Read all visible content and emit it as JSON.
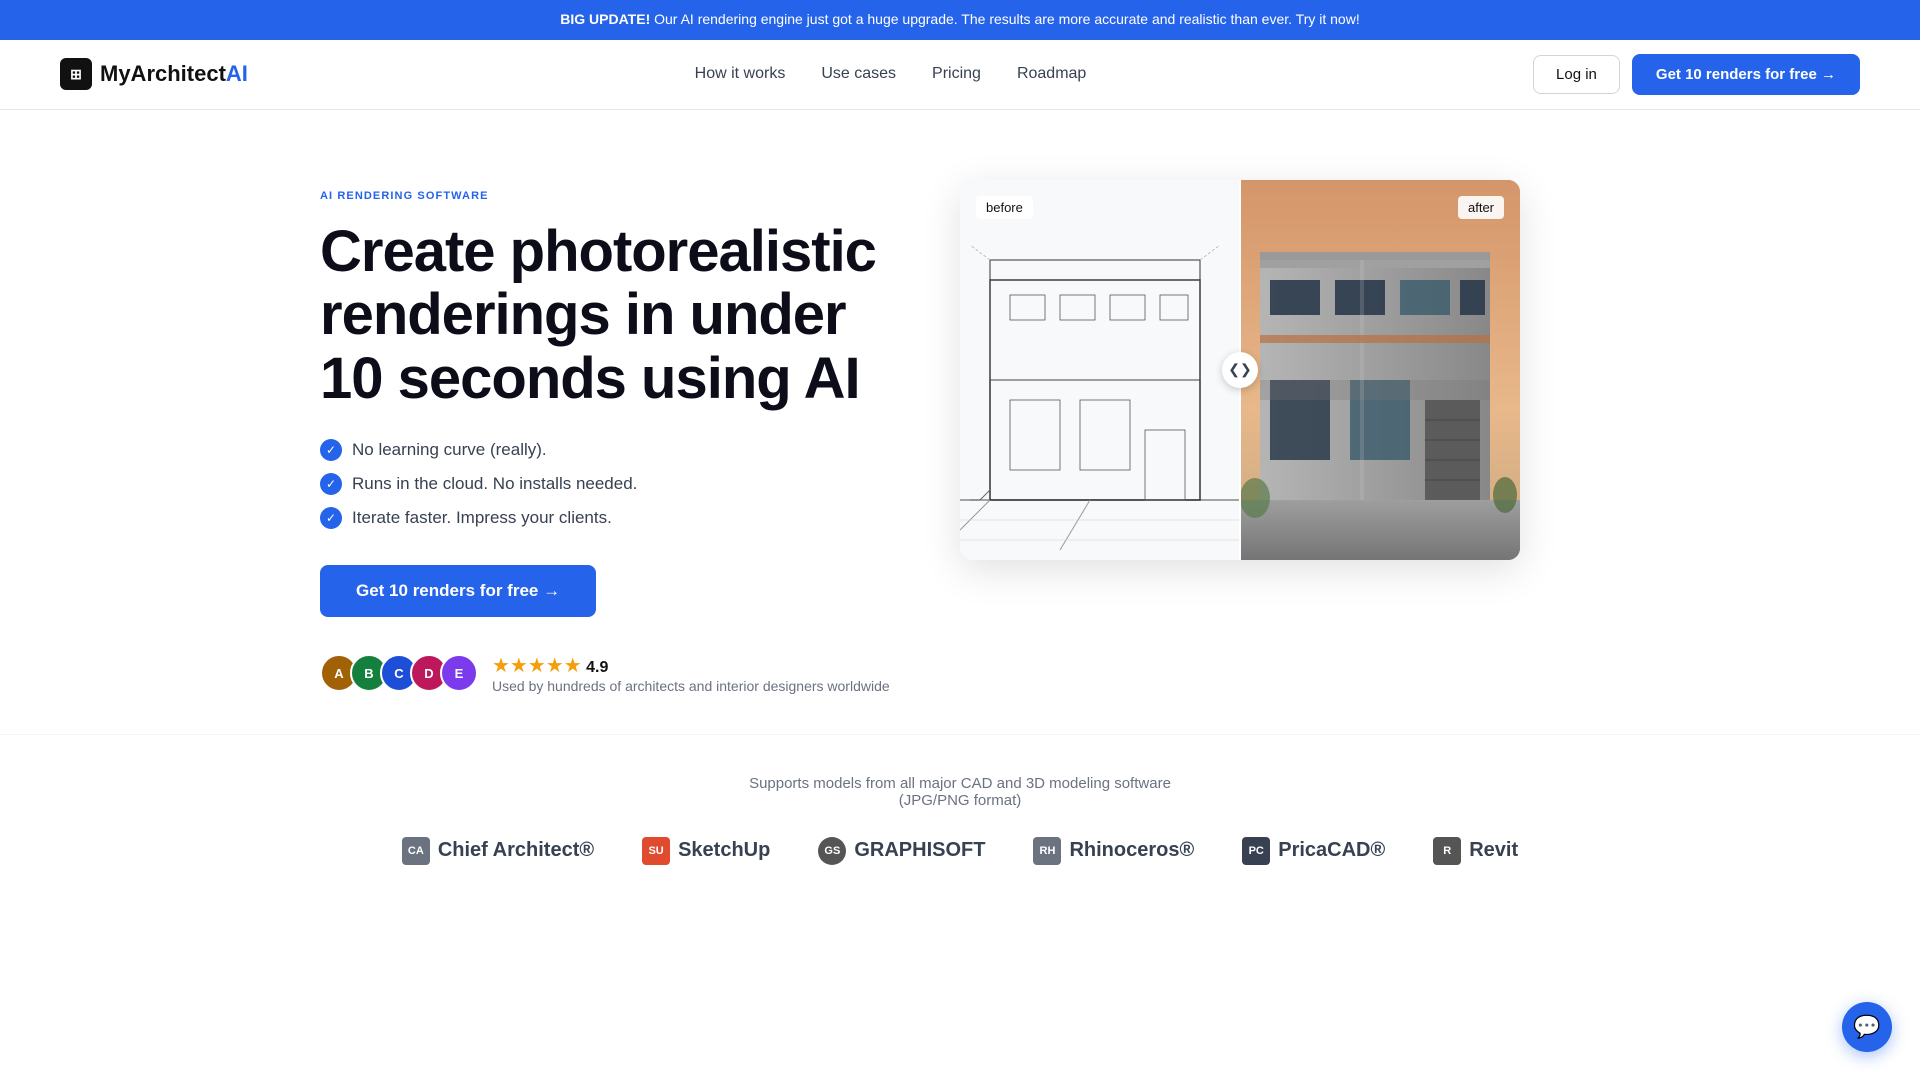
{
  "banner": {
    "bold_text": "BIG UPDATE!",
    "text": " Our AI rendering engine just got a huge upgrade. The results are more accurate and realistic than ever. Try it now!"
  },
  "nav": {
    "logo_text": "MyArchitect",
    "logo_ai": "AI",
    "logo_icon": "⚙",
    "links": [
      {
        "label": "How it works",
        "href": "#"
      },
      {
        "label": "Use cases",
        "href": "#"
      },
      {
        "label": "Pricing",
        "href": "#"
      },
      {
        "label": "Roadmap",
        "href": "#"
      }
    ],
    "login_label": "Log in",
    "cta_label": "Get 10 renders for free →"
  },
  "hero": {
    "badge": "AI RENDERING SOFTWARE",
    "title": "Create photorealistic renderings in under 10 seconds using AI",
    "features": [
      "No learning curve (really).",
      "Runs in the cloud. No installs needed.",
      "Iterate faster. Impress your clients."
    ],
    "cta_label": "Get 10 renders for free →",
    "rating": "4.9",
    "rating_text": "Used by hundreds of architects and interior designers worldwide",
    "before_label": "before",
    "after_label": "after"
  },
  "brands": {
    "subtitle": "Supports models from all major CAD and 3D modeling software\n(JPG/PNG format)",
    "items": [
      {
        "name": "Chief Architect®",
        "icon": "CA"
      },
      {
        "name": "SketchUp",
        "icon": "SU"
      },
      {
        "name": "GRAPHISOFT",
        "icon": "GS"
      },
      {
        "name": "Rhinoceros®",
        "icon": "RH"
      },
      {
        "name": "PricaCAD®",
        "icon": "PC"
      },
      {
        "name": "Revit",
        "icon": "R"
      }
    ]
  }
}
